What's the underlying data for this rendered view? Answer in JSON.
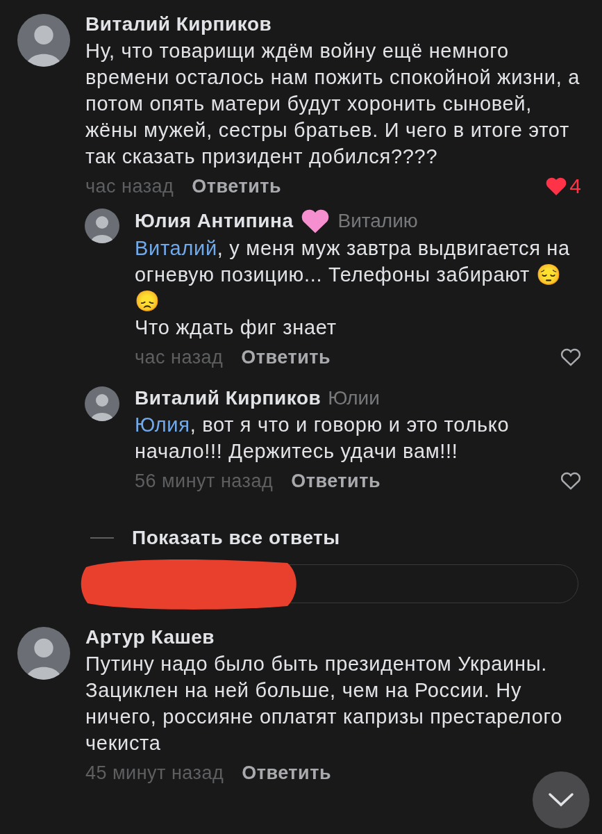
{
  "comments": [
    {
      "author": "Виталий Кирпиков",
      "text": "Ну, что товарищи ждём войну ещё немного времени осталось нам пожить спокойной жизни, а потом опять матери будут хоронить сыновей, жёны мужей, сестры братьев. И чего в итоге этот так сказать призидент добился????",
      "time": "час назад",
      "reply_label": "Ответить",
      "liked": true,
      "like_count": "4",
      "replies": [
        {
          "author": "Юлия Антипина",
          "heart_badge": true,
          "reply_to": "Виталию",
          "mention": "Виталий",
          "text": ", у меня муж завтра выдвигается на огневую позицию... Телефоны забирают 😔 😞\nЧто ждать фиг знает",
          "time": "час назад",
          "reply_label": "Ответить",
          "liked": false
        },
        {
          "author": "Виталий Кирпиков",
          "reply_to": "Юлии",
          "mention": "Юлия",
          "text": ", вот я что и говорю и это только начало!!! Держитесь удачи вам!!!",
          "time": "56 минут назад",
          "reply_label": "Ответить",
          "liked": false
        }
      ],
      "show_all": "Показать все ответы"
    },
    {
      "author": "Артур Кашев",
      "text": "Путину надо было быть президентом Украины. Зациклен на ней больше, чем на России. Ну ничего, россияне оплатят капризы престарелого чекиста",
      "time": "45 минут назад",
      "reply_label": "Ответить"
    }
  ]
}
